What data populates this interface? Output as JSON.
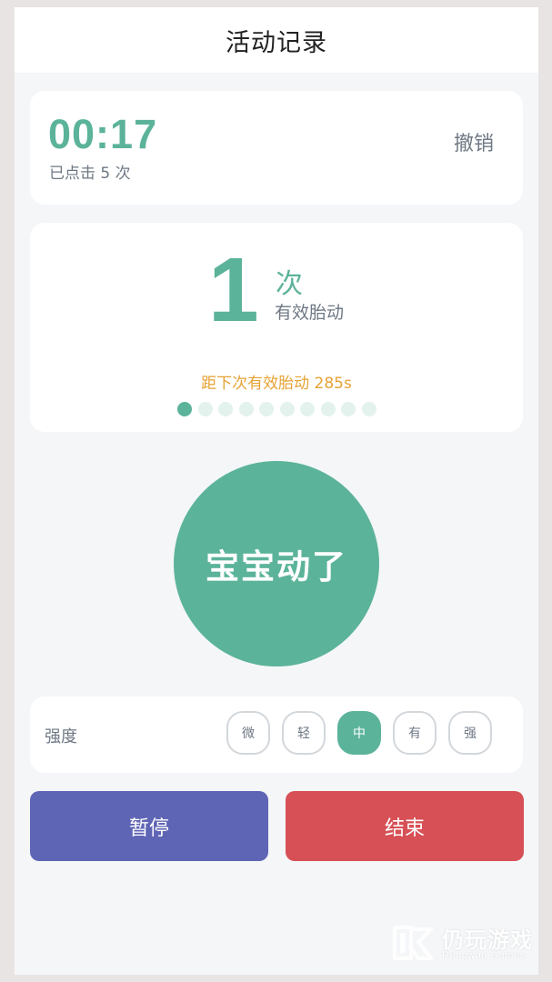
{
  "header": {
    "title": "活动记录"
  },
  "timer": {
    "value": "00:17",
    "tap_count_text": "已点击 5 次",
    "undo_label": "撤销"
  },
  "counter": {
    "number": "1",
    "unit": "次",
    "description": "有效胎动",
    "next_hint": "距下次有效胎动 285s",
    "progress": {
      "total_dots": 10,
      "active_dots": 1
    }
  },
  "main_button": {
    "label": "宝宝动了"
  },
  "intensity": {
    "label": "强度",
    "options": [
      "微",
      "轻",
      "中",
      "有",
      "强"
    ],
    "selected": "中"
  },
  "actions": {
    "pause_label": "暂停",
    "finish_label": "结束"
  },
  "watermark": {
    "name": "仍玩游戏",
    "subtitle": "Rengwan Games"
  },
  "colors": {
    "accent": "#5bb39a",
    "hint": "#e6a234",
    "pause": "#5f65b5",
    "finish": "#d65055",
    "background": "#f4f6f8"
  }
}
